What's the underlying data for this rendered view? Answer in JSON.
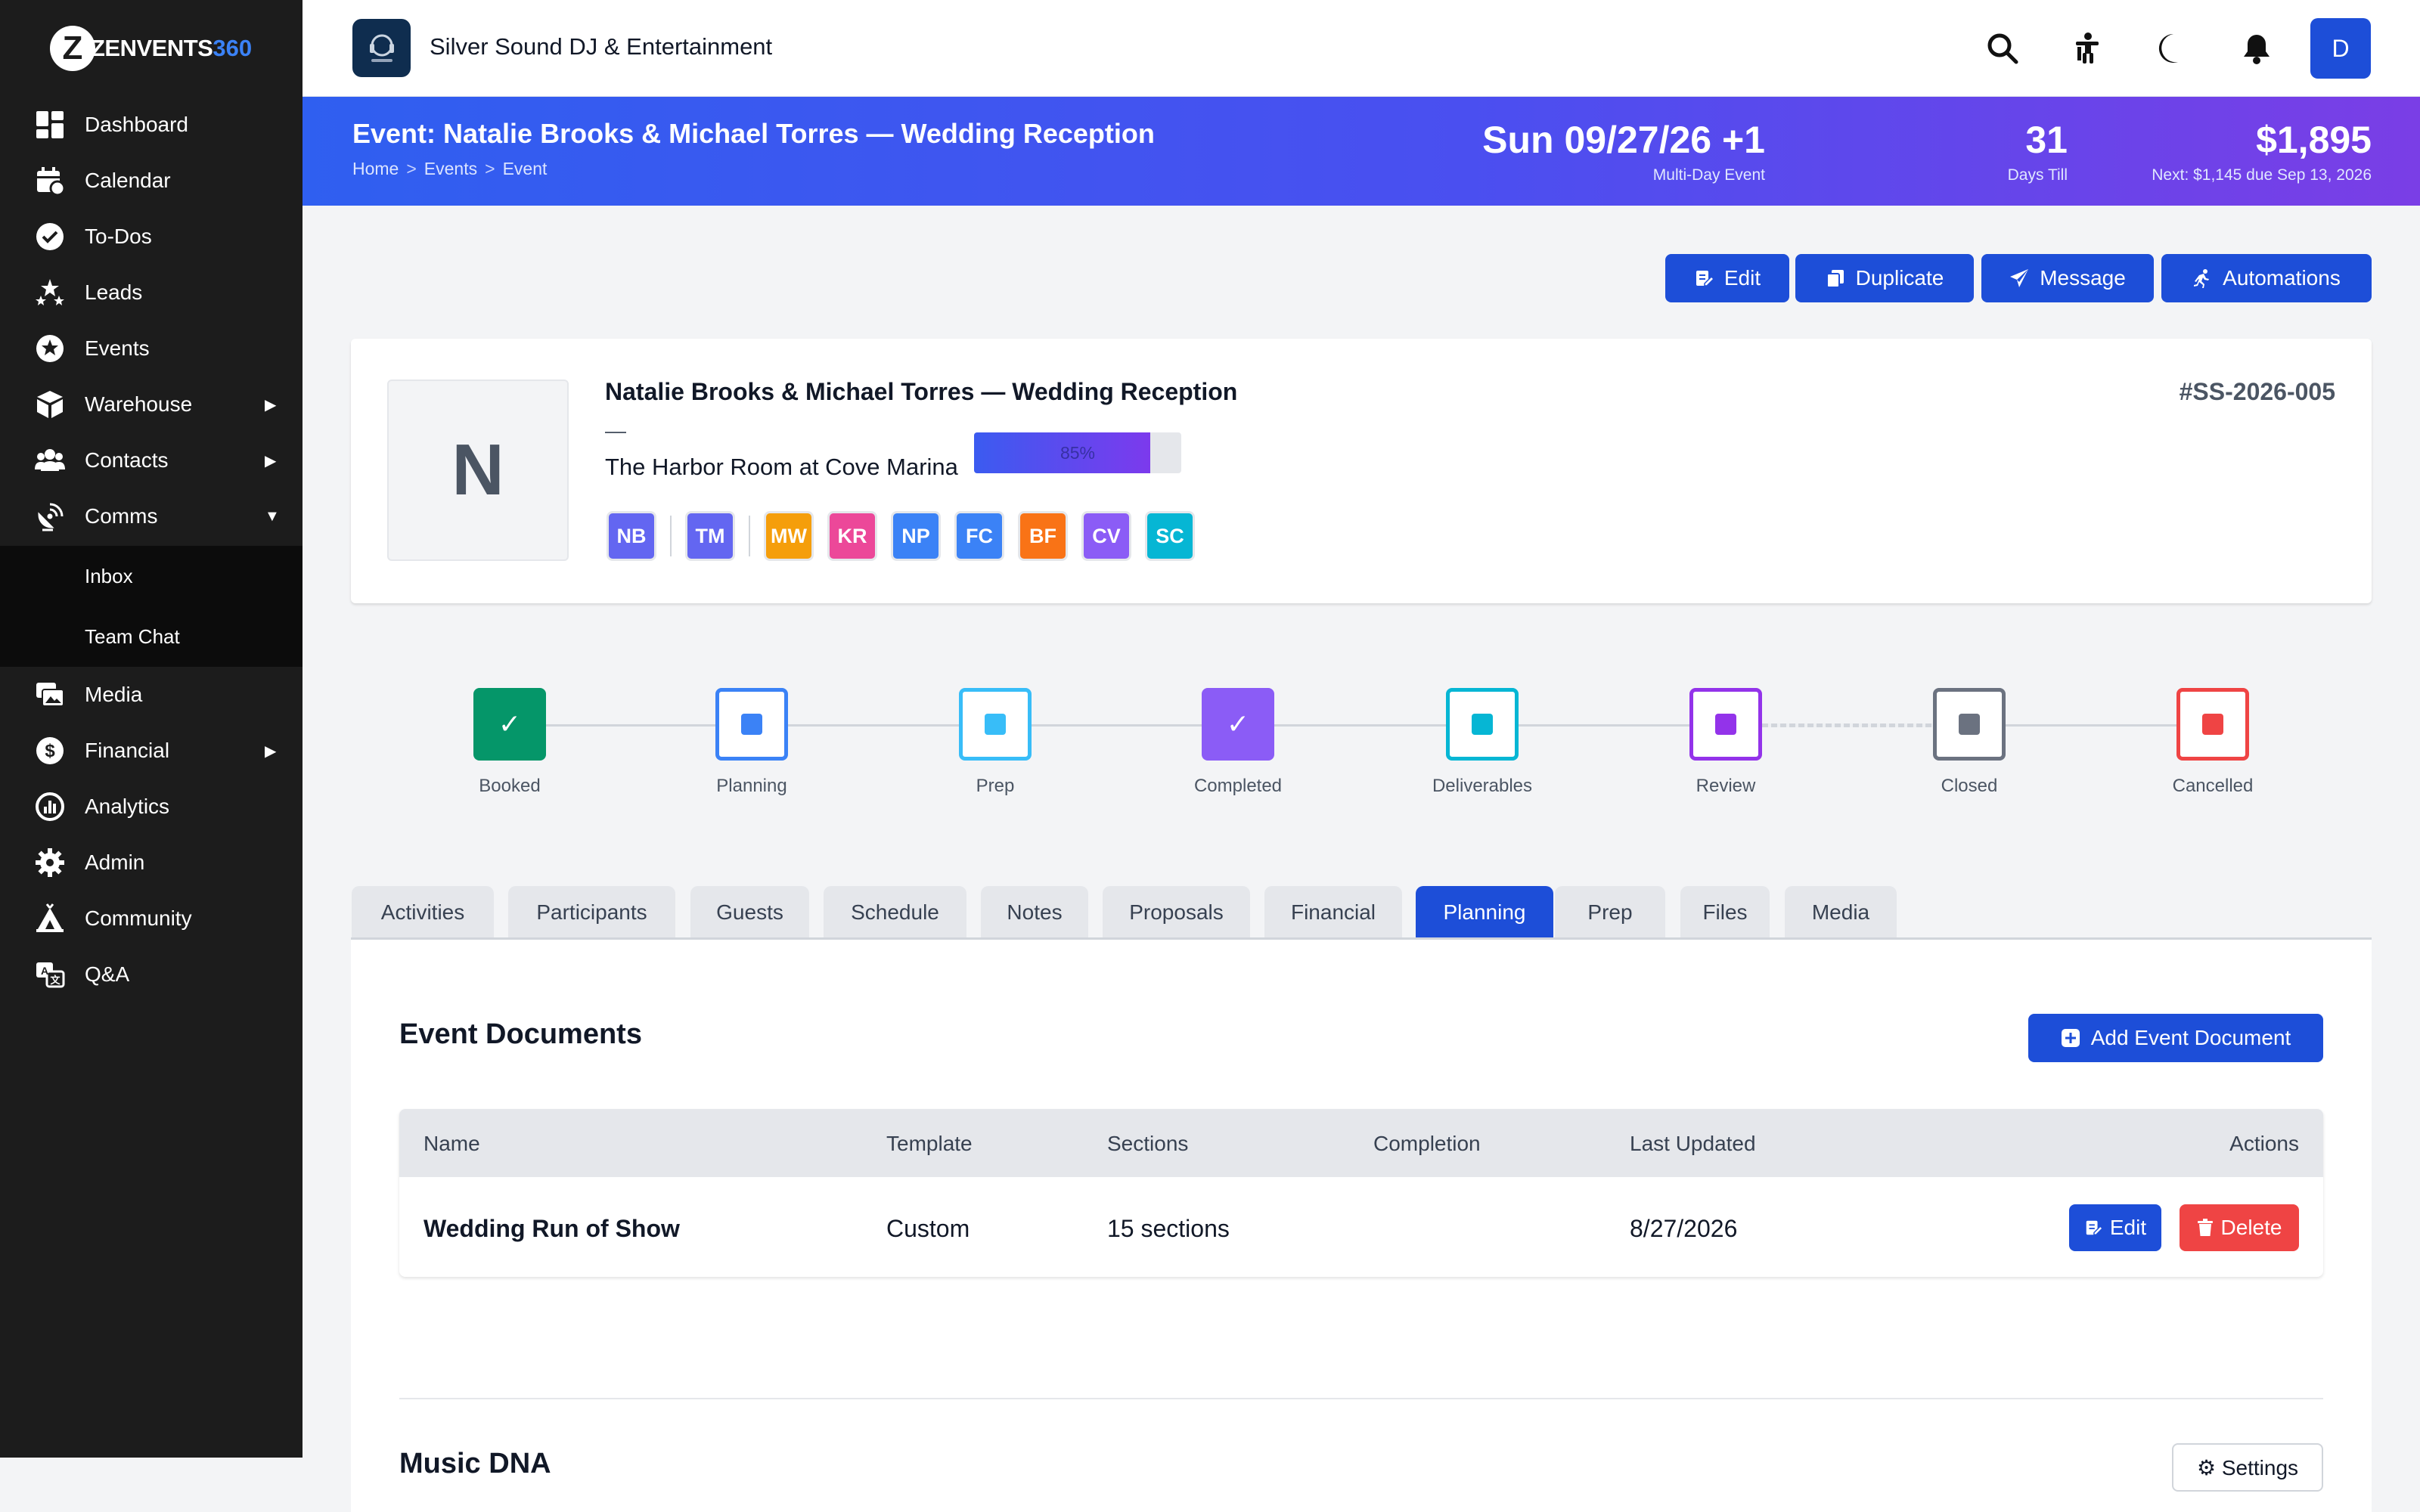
{
  "app": {
    "brand_z": "Z",
    "brand_word": "ZENVENTS",
    "brand_num": "360"
  },
  "sidebar": {
    "items": [
      {
        "label": "Dashboard",
        "icon": "dashboard-icon"
      },
      {
        "label": "Calendar",
        "icon": "calendar-icon"
      },
      {
        "label": "To-Dos",
        "icon": "check-circle-icon"
      },
      {
        "label": "Leads",
        "icon": "stars-icon"
      },
      {
        "label": "Events",
        "icon": "star-circle-icon"
      },
      {
        "label": "Warehouse",
        "icon": "box-icon",
        "arrow": "▶"
      },
      {
        "label": "Contacts",
        "icon": "users-icon",
        "arrow": "▶"
      },
      {
        "label": "Comms",
        "icon": "satellite-icon",
        "arrow": "▼"
      },
      {
        "label": "Media",
        "icon": "photos-icon"
      },
      {
        "label": "Financial",
        "icon": "dollar-icon",
        "arrow": "▶"
      },
      {
        "label": "Analytics",
        "icon": "chart-icon"
      },
      {
        "label": "Admin",
        "icon": "gear-icon"
      },
      {
        "label": "Community",
        "icon": "campground-icon"
      },
      {
        "label": "Q&A",
        "icon": "language-icon"
      }
    ],
    "subitems": [
      {
        "label": "Inbox"
      },
      {
        "label": "Team Chat"
      }
    ]
  },
  "topbar": {
    "business_name": "Silver Sound DJ & Entertainment",
    "avatar_initial": "D"
  },
  "banner": {
    "title": "Event: Natalie Brooks & Michael Torres — Wedding Reception",
    "breadcrumbs": [
      "Home",
      "Events",
      "Event"
    ],
    "crumb_sep": ">",
    "date": "Sun 09/27/26 +1",
    "date_sub": "Multi-Day Event",
    "days": "31",
    "days_sub": "Days Till",
    "amount": "$1,895",
    "amount_sub": "Next: $1,145 due Sep 13, 2026"
  },
  "actions": {
    "edit": "Edit",
    "duplicate": "Duplicate",
    "message": "Message",
    "automations": "Automations"
  },
  "event": {
    "initial": "N",
    "name": "Natalie Brooks & Michael Torres — Wedding Reception",
    "dash": "—",
    "venue": "The Harbor Room at Cove Marina",
    "number": "#SS-2026-005",
    "participants": [
      {
        "initials": "NB",
        "color": "#6366f1"
      },
      {
        "initials": "TM",
        "color": "#6366f1"
      },
      {
        "initials": "MW",
        "color": "#f59e0b"
      },
      {
        "initials": "KR",
        "color": "#ec4899"
      },
      {
        "initials": "NP",
        "color": "#3b82f6"
      },
      {
        "initials": "FC",
        "color": "#3b82f6"
      },
      {
        "initials": "BF",
        "color": "#f97316"
      },
      {
        "initials": "CV",
        "color": "#8b5cf6"
      },
      {
        "initials": "SC",
        "color": "#06b6d4"
      }
    ]
  },
  "stages": [
    {
      "label": "Booked",
      "color": "#059669",
      "state": "done",
      "mark": "✓"
    },
    {
      "label": "Planning",
      "color": "#3b82f6",
      "state": "pending"
    },
    {
      "label": "Prep",
      "color": "#38bdf8",
      "state": "pending"
    },
    {
      "label": "Completed",
      "color": "#8b5cf6",
      "state": "done",
      "mark": "✓"
    },
    {
      "label": "Deliverables",
      "color": "#06b6d4",
      "state": "pending"
    },
    {
      "label": "Review",
      "color": "#9333ea",
      "state": "pending"
    },
    {
      "label": "Closed",
      "color": "#6b7280",
      "state": "pending"
    },
    {
      "label": "Cancelled",
      "color": "#ef4444",
      "state": "pending"
    }
  ],
  "tabs": [
    {
      "label": "Activities"
    },
    {
      "label": "Participants"
    },
    {
      "label": "Guests"
    },
    {
      "label": "Schedule"
    },
    {
      "label": "Notes"
    },
    {
      "label": "Proposals"
    },
    {
      "label": "Financial"
    },
    {
      "label": "Planning",
      "active": true
    },
    {
      "label": "Prep"
    },
    {
      "label": "Files"
    },
    {
      "label": "Media"
    }
  ],
  "documents": {
    "title": "Event Documents",
    "add_label": "Add Event Document",
    "columns": {
      "name": "Name",
      "template": "Template",
      "sections": "Sections",
      "completion": "Completion",
      "updated": "Last Updated",
      "actions": "Actions"
    },
    "rows": [
      {
        "name": "Wedding Run of Show",
        "template": "Custom",
        "sections": "15 sections",
        "completion": 85,
        "completion_label": "85%",
        "updated": "8/27/2026",
        "edit": "Edit",
        "delete": "Delete"
      }
    ]
  },
  "music_dna": {
    "title": "Music DNA",
    "settings_label": "⚙ Settings"
  },
  "colors": {
    "primary": "#1d4ed8",
    "danger": "#ef4444",
    "sidebar": "#1c1c1c"
  }
}
